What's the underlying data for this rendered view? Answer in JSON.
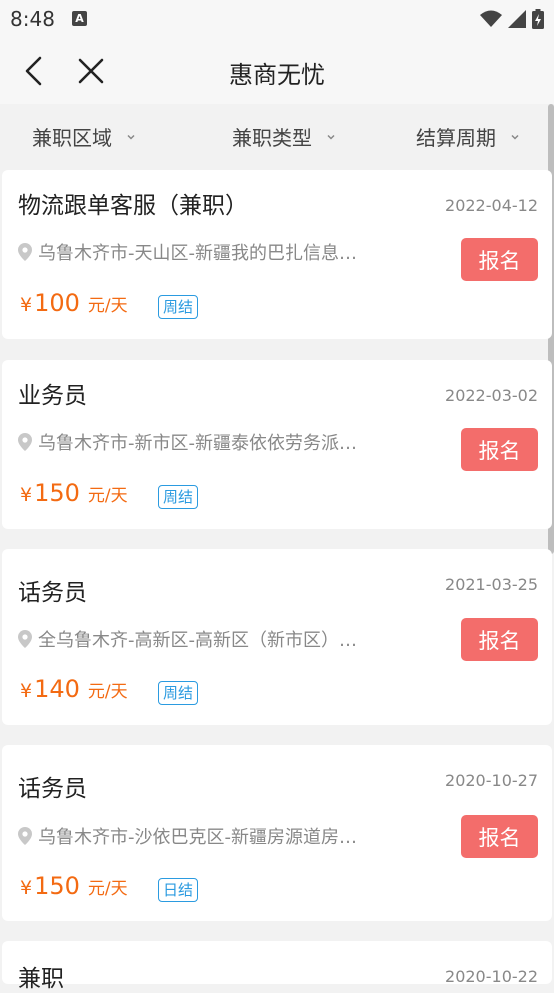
{
  "status": {
    "time": "8:48",
    "notif_icon_letter": "A"
  },
  "header": {
    "title": "惠商无忧"
  },
  "filters": [
    {
      "label": "兼职区域"
    },
    {
      "label": "兼职类型"
    },
    {
      "label": "结算周期"
    }
  ],
  "jobs": [
    {
      "title": "物流跟单客服（兼职）",
      "date": "2022-04-12",
      "location": "乌鲁木齐市-天山区-新疆我的巴扎信息…",
      "currency": "¥",
      "amount": "100",
      "unit": "元/天",
      "cycle": "周结",
      "apply": "报名"
    },
    {
      "title": "业务员",
      "date": "2022-03-02",
      "location": "乌鲁木齐市-新市区-新疆泰依依劳务派…",
      "currency": "¥",
      "amount": "150",
      "unit": "元/天",
      "cycle": "周结",
      "apply": "报名"
    },
    {
      "title": "话务员",
      "date": "2021-03-25",
      "location": "全乌鲁木齐-高新区-高新区（新市区）…",
      "currency": "¥",
      "amount": "140",
      "unit": "元/天",
      "cycle": "周结",
      "apply": "报名"
    },
    {
      "title": "话务员",
      "date": "2020-10-27",
      "location": "乌鲁木齐市-沙依巴克区-新疆房源道房…",
      "currency": "¥",
      "amount": "150",
      "unit": "元/天",
      "cycle": "日结",
      "apply": "报名"
    },
    {
      "title": "兼职",
      "date": "2020-10-22"
    }
  ],
  "colors": {
    "price": "#f36a12",
    "apply": "#f36d6b",
    "badge": "#2b9be0"
  }
}
